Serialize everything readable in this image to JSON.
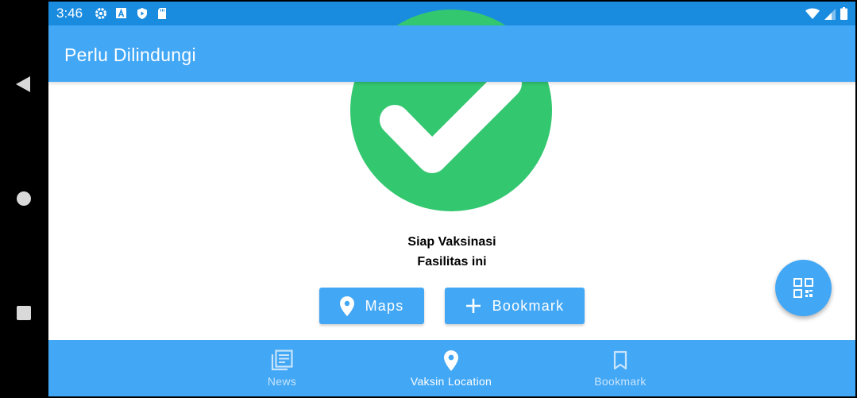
{
  "status_bar": {
    "time": "3:46",
    "left_icons": [
      "settings-icon",
      "font-a-icon",
      "shield-play-icon",
      "sd-card-icon"
    ],
    "right_icons": [
      "wifi-icon",
      "signal-icon",
      "battery-icon"
    ]
  },
  "app_bar": {
    "title": "Perlu Dilindungi"
  },
  "main": {
    "status_icon": "check-circle-icon",
    "status_line1": "Siap Vaksinasi",
    "status_line2": "Fasilitas ini",
    "maps_label": "Maps",
    "bookmark_label": "Bookmark"
  },
  "fab": {
    "icon": "qr-code-icon"
  },
  "bottom_nav": {
    "items": [
      {
        "label": "News",
        "icon": "news-icon",
        "active": false
      },
      {
        "label": "Vaksin Location",
        "icon": "location-pin-icon",
        "active": true
      },
      {
        "label": "Bookmark",
        "icon": "bookmark-icon",
        "active": false
      }
    ]
  },
  "colors": {
    "status_bar": "#1a8ce0",
    "primary": "#42a7f5",
    "success": "#33c76f",
    "inactive_nav": "#c8e4fb"
  },
  "system_nav": [
    "back-icon",
    "home-icon",
    "recents-icon"
  ]
}
